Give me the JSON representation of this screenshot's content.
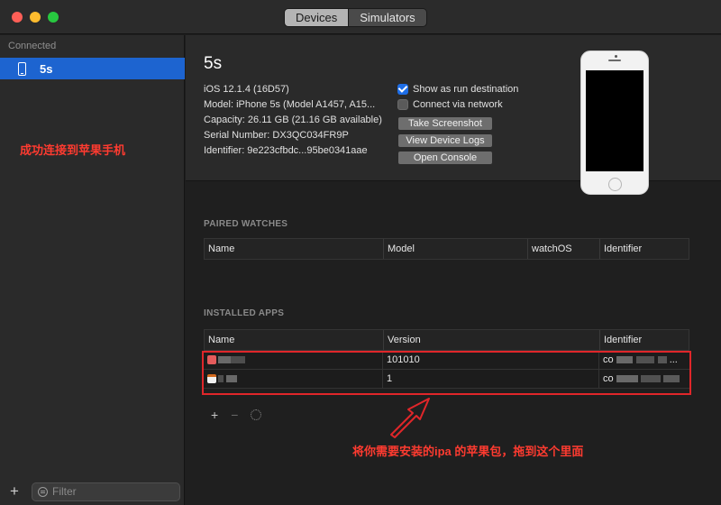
{
  "titlebar": {
    "tabs": [
      {
        "label": "Devices",
        "active": true
      },
      {
        "label": "Simulators",
        "active": false
      }
    ]
  },
  "sidebar": {
    "section": "Connected",
    "items": [
      {
        "label": "5s",
        "selected": true,
        "icon": "iphone-icon"
      }
    ],
    "annotation": "成功连接到苹果手机",
    "filter_placeholder": "Filter",
    "add_label": "+"
  },
  "device": {
    "name": "5s",
    "os": "iOS 12.1.4 (16D57)",
    "model": "Model: iPhone 5s (Model A1457, A15...",
    "capacity": "Capacity: 26.11 GB (21.16 GB available)",
    "serial": "Serial Number: DX3QC034FR9P",
    "identifier": "Identifier: 9e223cfbdc...95be0341aae",
    "show_run_destination": {
      "label": "Show as run destination",
      "checked": true
    },
    "connect_network": {
      "label": "Connect via network",
      "checked": false
    },
    "buttons": [
      "Take Screenshot",
      "View Device Logs",
      "Open Console"
    ]
  },
  "paired_watches": {
    "title": "PAIRED WATCHES",
    "columns": [
      "Name",
      "Model",
      "watchOS",
      "Identifier"
    ]
  },
  "installed_apps": {
    "title": "INSTALLED APPS",
    "columns": [
      "Name",
      "Version",
      "Identifier"
    ],
    "rows": [
      {
        "version": "101010",
        "identifier_prefix": "co",
        "identifier_suffix": "..."
      },
      {
        "version": "1",
        "identifier_prefix": "co",
        "identifier_suffix": "..."
      }
    ],
    "tools": {
      "add": "+",
      "remove": "−"
    }
  },
  "annotation_bottom": "将你需要安装的ipa 的苹果包，拖到这个里面",
  "colors": {
    "accent": "#1d64d0",
    "annotation": "#ff3b30",
    "highlight": "#e0262a"
  }
}
